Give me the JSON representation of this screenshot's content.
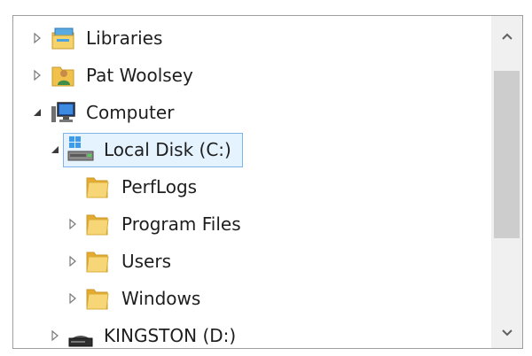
{
  "tree": {
    "items": [
      {
        "label": "Libraries",
        "icon": "libraries-icon",
        "expander": "collapsed"
      },
      {
        "label": "Pat Woolsey",
        "icon": "user-folder-icon",
        "expander": "collapsed"
      },
      {
        "label": "Computer",
        "icon": "computer-icon",
        "expander": "expanded"
      },
      {
        "label": "Local Disk (C:)",
        "icon": "local-disk-icon",
        "expander": "expanded",
        "selected": true
      },
      {
        "label": "PerfLogs",
        "icon": "folder-icon",
        "expander": "none"
      },
      {
        "label": "Program Files",
        "icon": "folder-icon",
        "expander": "collapsed"
      },
      {
        "label": "Users",
        "icon": "folder-icon",
        "expander": "collapsed"
      },
      {
        "label": "Windows",
        "icon": "folder-icon",
        "expander": "collapsed"
      },
      {
        "label": "KINGSTON (D:)",
        "icon": "usb-drive-icon",
        "expander": "collapsed"
      }
    ]
  },
  "scrollbar": {
    "up_icon": "chevron-up-icon",
    "down_icon": "chevron-down-icon"
  },
  "colors": {
    "selection_fill": "#e5f3ff",
    "selection_border": "#7eb4ea",
    "folder": "#f0c24b",
    "scroll_thumb": "#cdcdcd"
  }
}
